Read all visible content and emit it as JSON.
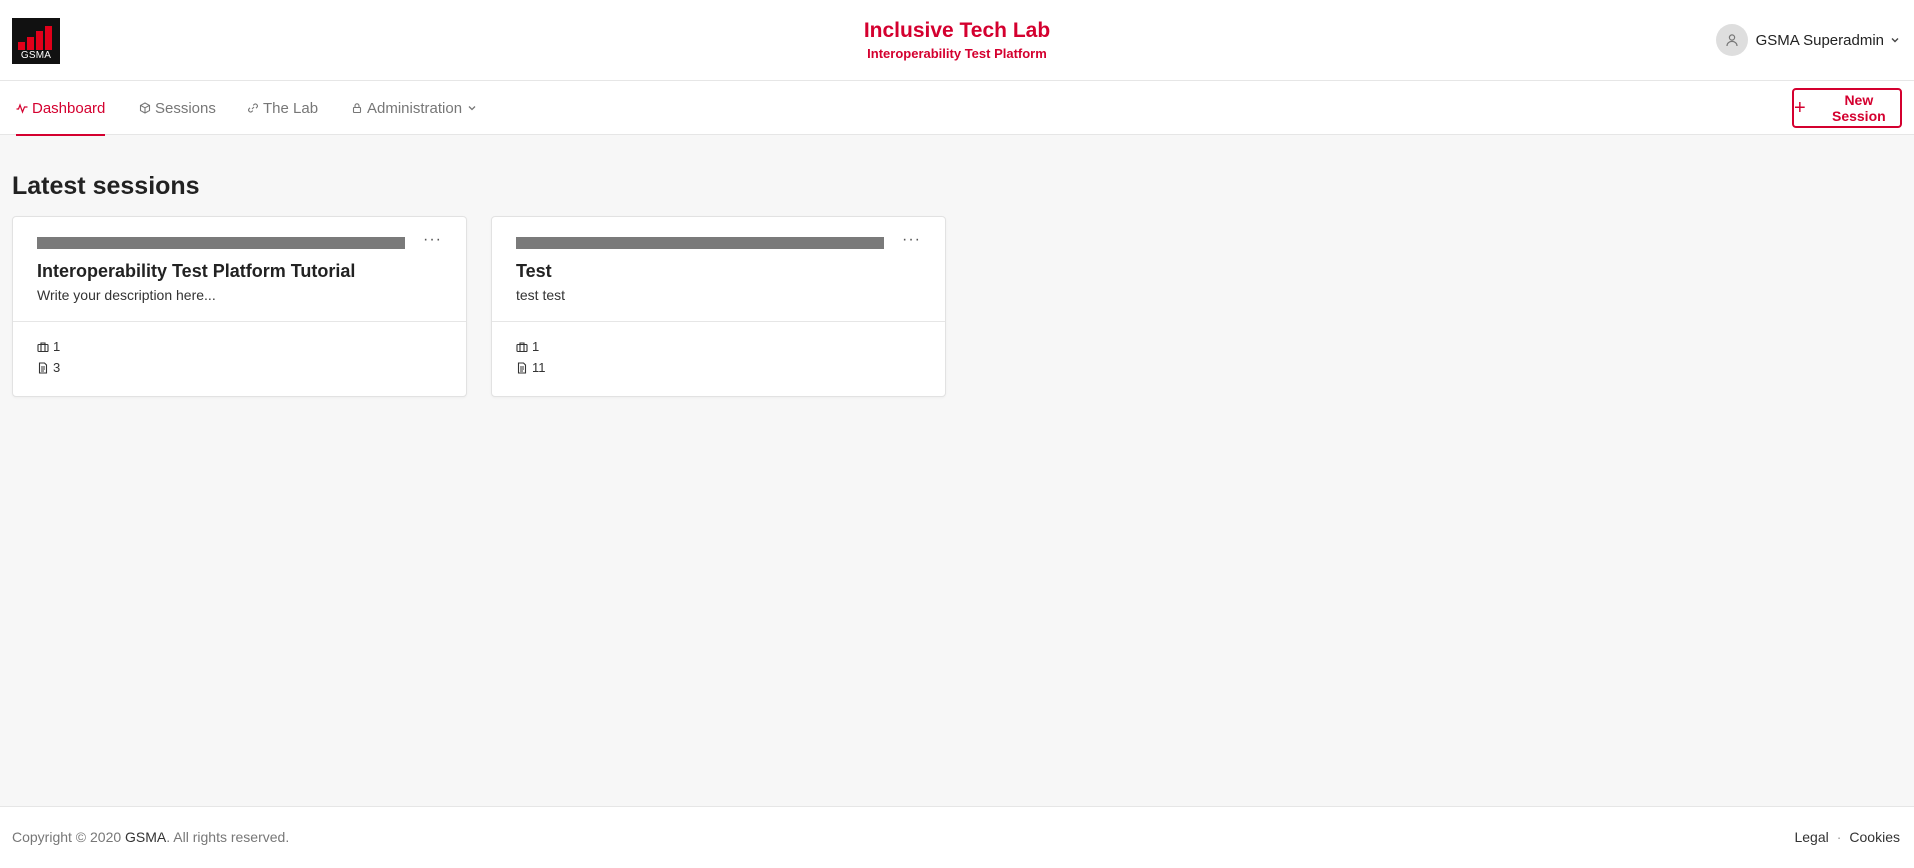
{
  "header": {
    "logo_text": "GSMA",
    "title": "Inclusive Tech Lab",
    "subtitle": "Interoperability Test Platform",
    "user_name": "GSMA Superadmin",
    "user_icon": "user-icon",
    "brand_color": "#d4002f"
  },
  "nav": {
    "items": [
      {
        "label": "Dashboard",
        "icon": "pulse-icon",
        "active": true
      },
      {
        "label": "Sessions",
        "icon": "cube-icon",
        "active": false
      },
      {
        "label": "The Lab",
        "icon": "link-icon",
        "active": false
      },
      {
        "label": "Administration",
        "icon": "lock-icon",
        "active": false
      }
    ],
    "new_session_label": "New Session"
  },
  "main": {
    "section_title": "Latest sessions",
    "sessions": [
      {
        "title": "Interoperability Test Platform Tutorial",
        "description": "Write your description here...",
        "components": "1",
        "test_cases": "3"
      },
      {
        "title": "Test",
        "description": "test test",
        "components": "1",
        "test_cases": "11"
      }
    ]
  },
  "footer": {
    "copyright_prefix": "Copyright © 2020 ",
    "copyright_org": "GSMA",
    "copyright_suffix": ". All rights reserved.",
    "links": [
      "Legal",
      "Cookies"
    ]
  }
}
